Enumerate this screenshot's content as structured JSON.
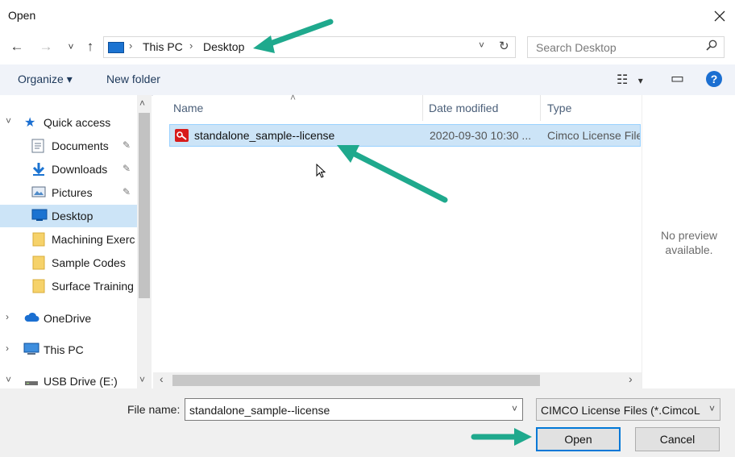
{
  "window": {
    "title": "Open",
    "close_icon": "close-icon"
  },
  "nav_buttons": {
    "back": "←",
    "forward": "→",
    "recent": "˅",
    "up": "↑"
  },
  "address": {
    "crumbs": [
      "This PC",
      "Desktop"
    ],
    "sep": "›",
    "dropdown": "˅",
    "refresh": "↻"
  },
  "search": {
    "placeholder": "Search Desktop",
    "icon": "⚲"
  },
  "toolbar": {
    "organize": "Organize",
    "organize_arrow": "▾",
    "new_folder": "New folder",
    "view_icon": "☷",
    "view_arrow": "▾",
    "pane_icon": "▭",
    "help": "?"
  },
  "nav_tree": [
    {
      "label": "Quick access",
      "expander": "˅",
      "icon": "star-icon"
    },
    {
      "label": "Documents",
      "icon": "documents-icon",
      "pin": "📌"
    },
    {
      "label": "Downloads",
      "icon": "downloads-icon",
      "pin": "📌"
    },
    {
      "label": "Pictures",
      "icon": "pictures-icon",
      "pin": "📌"
    },
    {
      "label": "Desktop",
      "icon": "desktop-icon",
      "selected": true
    },
    {
      "label": "Machining Exerc",
      "icon": "folder-icon"
    },
    {
      "label": "Sample Codes",
      "icon": "folder-icon"
    },
    {
      "label": "Surface Training",
      "icon": "folder-icon"
    },
    {
      "label": "OneDrive",
      "expander": "›",
      "icon": "cloud-icon"
    },
    {
      "label": "This PC",
      "expander": "›",
      "icon": "pc-icon"
    },
    {
      "label": "USB Drive (E:)",
      "expander": "˅",
      "icon": "usb-icon"
    }
  ],
  "columns": {
    "name": "Name",
    "date": "Date modified",
    "type": "Type",
    "sort_glyph": "˄"
  },
  "files": [
    {
      "name": "standalone_sample--license",
      "date": "2020-09-30 10:30 ...",
      "type": "Cimco License File"
    }
  ],
  "scroll": {
    "up": "˄",
    "down": "˅",
    "left": "‹",
    "right": "›"
  },
  "preview": {
    "line1": "No preview",
    "line2": "available."
  },
  "bottom": {
    "filename_label": "File name:",
    "filename_value": "standalone_sample--license",
    "filetype_value": "CIMCO License Files (*.CimcoL",
    "dropdown": "˅",
    "open_label": "Open",
    "cancel_label": "Cancel"
  },
  "colors": {
    "selection": "#cce4f7",
    "accent": "#0078d7",
    "arrow": "#1fa98d"
  }
}
